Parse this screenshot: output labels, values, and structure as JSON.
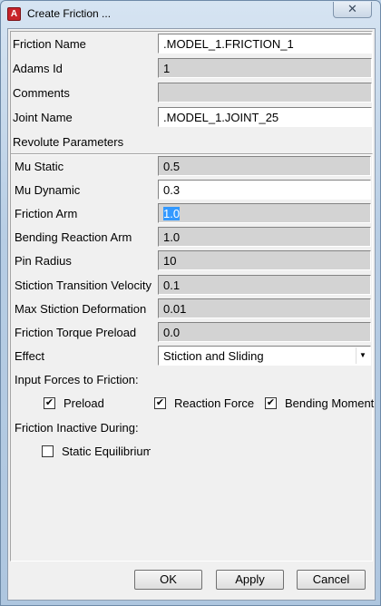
{
  "window": {
    "title": "Create Friction ...",
    "app_icon_letter": "A",
    "close_glyph": "✕"
  },
  "form": {
    "friction_name": {
      "label": "Friction Name",
      "value": ".MODEL_1.FRICTION_1"
    },
    "adams_id": {
      "label": "Adams Id",
      "value": "1"
    },
    "comments": {
      "label": "Comments",
      "value": ""
    },
    "joint_name": {
      "label": "Joint Name",
      "value": ".MODEL_1.JOINT_25"
    },
    "section_label": "Revolute Parameters"
  },
  "params": {
    "mu_static": {
      "label": "Mu Static",
      "value": "0.5"
    },
    "mu_dynamic": {
      "label": "Mu Dynamic",
      "value": "0.3"
    },
    "friction_arm": {
      "label": "Friction Arm",
      "value": "1.0"
    },
    "bending_reaction_arm": {
      "label": "Bending Reaction Arm",
      "value": "1.0"
    },
    "pin_radius": {
      "label": "Pin Radius",
      "value": "10"
    },
    "stiction_transition_velocity": {
      "label": "Stiction Transition Velocity",
      "value": "0.1"
    },
    "max_stiction_deformation": {
      "label": "Max Stiction Deformation",
      "value": "0.01"
    },
    "friction_torque_preload": {
      "label": "Friction Torque Preload",
      "value": "0.0"
    },
    "effect": {
      "label": "Effect",
      "value": "Stiction and Sliding",
      "arrow_glyph": "▼"
    }
  },
  "input_forces": {
    "label": "Input Forces to Friction:",
    "preload": {
      "label": "Preload",
      "checked": true,
      "mark": "✔"
    },
    "reaction_force": {
      "label": "Reaction Force",
      "checked": true,
      "mark": "✔"
    },
    "bending_moment": {
      "label": "Bending Moment",
      "checked": true,
      "mark": "✔"
    }
  },
  "inactive": {
    "label": "Friction Inactive During:",
    "static_equilibrium": {
      "label": "Static Equilibrium",
      "checked": false,
      "mark": ""
    }
  },
  "buttons": {
    "ok": "OK",
    "apply": "Apply",
    "cancel": "Cancel"
  }
}
